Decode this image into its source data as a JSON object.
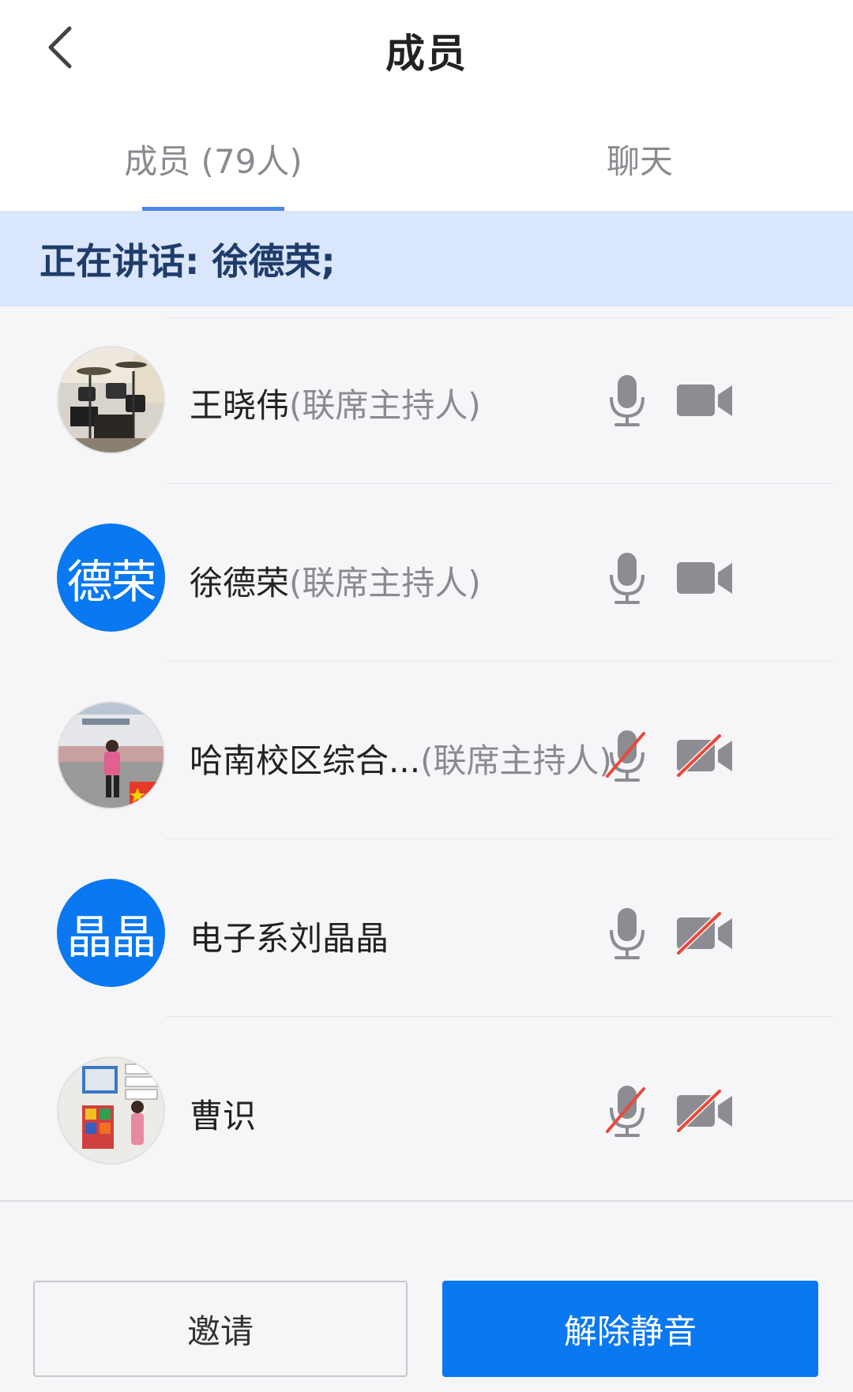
{
  "header": {
    "title": "成员"
  },
  "tabs": [
    {
      "label": "成员 (79人)",
      "active": true
    },
    {
      "label": "聊天",
      "active": false
    }
  ],
  "speaking": {
    "text": "正在讲话: 徐德荣;"
  },
  "colors": {
    "accent": "#0a78f0",
    "tab_indicator": "#4a84ec",
    "speaking_bg": "#d9e6fb",
    "muted_slash": "#e84a3a",
    "icon_gray": "#8c8c92"
  },
  "members": [
    {
      "name": "王晓伟",
      "role": "(联席主持人)",
      "avatar_type": "photo",
      "avatar_icon": "drum-kit-photo",
      "mic_on": true,
      "cam_on": true
    },
    {
      "name": "徐德荣",
      "role": "(联席主持人)",
      "avatar_type": "text",
      "avatar_text": "德荣",
      "mic_on": true,
      "cam_on": true
    },
    {
      "name": "哈南校区综合...",
      "role": "(联席主持人)",
      "avatar_type": "photo",
      "avatar_icon": "schoolyard-photo",
      "mic_on": false,
      "cam_on": false
    },
    {
      "name": "电子系刘晶晶",
      "role": "",
      "avatar_type": "text",
      "avatar_text": "晶晶",
      "mic_on": true,
      "cam_on": false
    },
    {
      "name": "曹识",
      "role": "",
      "avatar_type": "photo",
      "avatar_icon": "classroom-photo",
      "mic_on": false,
      "cam_on": false
    }
  ],
  "footer": {
    "invite_label": "邀请",
    "unmute_label": "解除静音"
  }
}
